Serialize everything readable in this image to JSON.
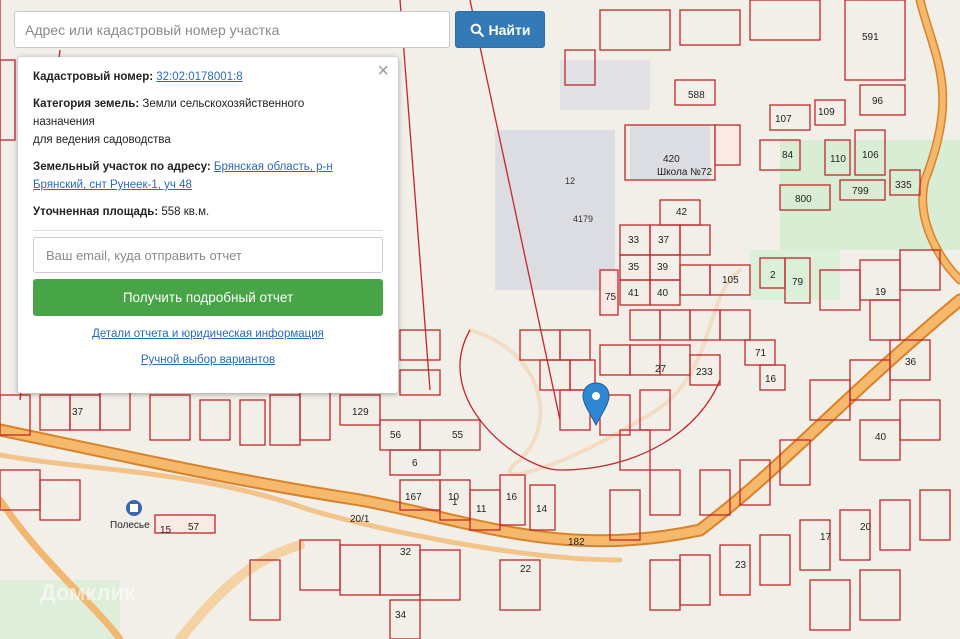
{
  "search": {
    "placeholder": "Адрес или кадастровый номер участка",
    "button_label": "Найти"
  },
  "info_panel": {
    "close_label": "×",
    "cadastral_label": "Кадастровый номер:",
    "cadastral_value": "32:02:0178001:8",
    "category_label": "Категория земель:",
    "category_value": "Земли сельскохозяйственного назначения",
    "category_usage": "для ведения садоводства",
    "address_label": "Земельный участок по адресу:",
    "address_value": "Брянская область, р-н Брянский, снт Рунеек-1, уч 48",
    "area_label": "Уточненная площадь:",
    "area_value": "558 кв.м.",
    "email_placeholder": "Ваш email, куда отправить отчет",
    "report_button": "Получить подробный отчет",
    "details_link": "Детали отчета и юридическая информация",
    "manual_link": "Ручной выбор вариантов"
  },
  "map": {
    "school_number": "420",
    "school_label": "Школа №72",
    "poi_label": "Полесье",
    "watermark": "Домклик",
    "plot_numbers": [
      "591",
      "588",
      "107",
      "109",
      "96",
      "84",
      "110",
      "106",
      "799",
      "800",
      "335",
      "4179",
      "12",
      "42",
      "37",
      "33",
      "35",
      "39",
      "40",
      "41",
      "105",
      "2",
      "79",
      "71",
      "16",
      "27",
      "233",
      "75",
      "19",
      "56",
      "55",
      "129",
      "6",
      "167",
      "1",
      "10",
      "11",
      "16",
      "14",
      "20/1",
      "182",
      "32",
      "22",
      "34",
      "15",
      "57",
      "37",
      "36",
      "40",
      "23",
      "17",
      "20"
    ],
    "colors": {
      "plot_stroke": "#c2262b",
      "road_orange": "#f0a244",
      "marker": "#2f86d1",
      "park_green": "#d6ecd2"
    }
  }
}
